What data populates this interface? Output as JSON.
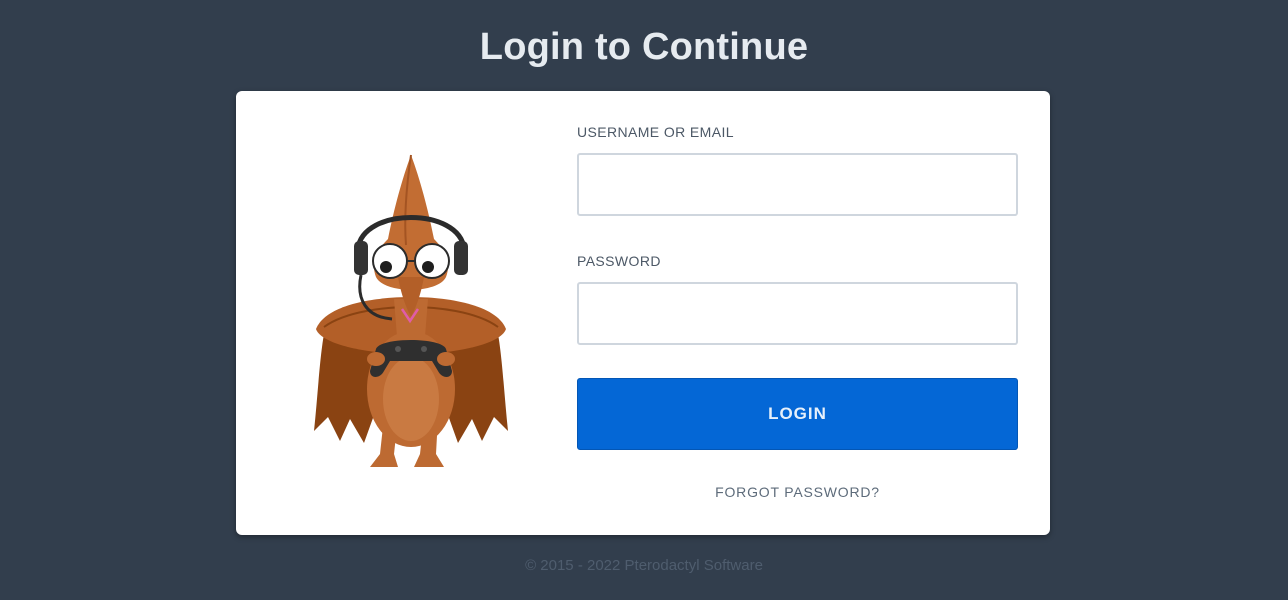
{
  "header": {
    "title": "Login to Continue"
  },
  "form": {
    "username_label": "USERNAME OR EMAIL",
    "username_value": "",
    "password_label": "PASSWORD",
    "password_value": "",
    "login_label": "LOGIN",
    "forgot_label": "FORGOT PASSWORD?"
  },
  "footer": {
    "copyright": "© 2015 - 2022 Pterodactyl Software"
  },
  "colors": {
    "background": "#323e4d",
    "card": "#ffffff",
    "primary": "#0467d6",
    "mascot_body": "#bd6a32",
    "mascot_wing": "#8a4312"
  },
  "icons": {
    "mascot": "pterodactyl-gamer-mascot"
  }
}
